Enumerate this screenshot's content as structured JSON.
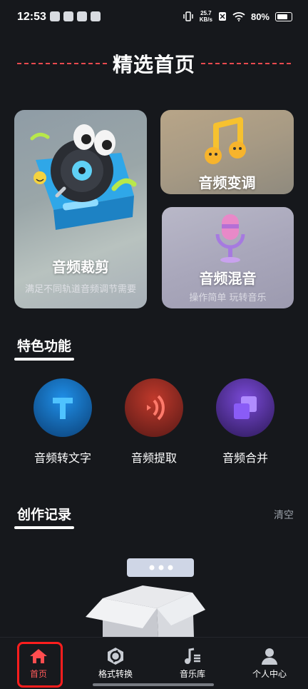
{
  "status": {
    "time": "12:53",
    "speed_value": "25.7",
    "speed_unit": "KB/s",
    "battery": "80%"
  },
  "page_title": "精选首页",
  "cards": [
    {
      "label": "音频裁剪",
      "sub": "满足不同轨道音频调节需要"
    },
    {
      "label": "音频变调"
    },
    {
      "label": "音频混音",
      "sub": "操作简单 玩转音乐"
    }
  ],
  "features_title": "特色功能",
  "features": [
    {
      "label": "音频转文字",
      "icon": "text-t-icon",
      "color": "#1e88e5"
    },
    {
      "label": "音频提取",
      "icon": "audio-wave-icon",
      "color": "#c0392b"
    },
    {
      "label": "音频合并",
      "icon": "merge-squares-icon",
      "color": "#7a4ad8"
    }
  ],
  "records_title": "创作记录",
  "clear_label": "清空",
  "nav": [
    {
      "label": "首页",
      "icon": "home-icon",
      "active": true
    },
    {
      "label": "格式转换",
      "icon": "convert-icon"
    },
    {
      "label": "音乐库",
      "icon": "music-library-icon"
    },
    {
      "label": "个人中心",
      "icon": "person-icon"
    }
  ],
  "accent_color": "#ff4d4f"
}
